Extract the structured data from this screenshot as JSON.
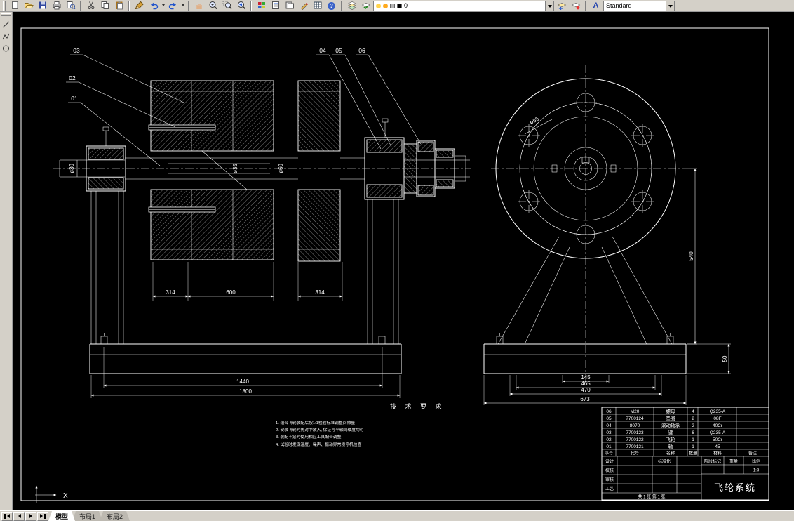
{
  "toolbar": {
    "layer_value": "0",
    "style_value": "Standard",
    "icons": {
      "help_glyph": "?",
      "style_glyph": "A"
    }
  },
  "tabs": {
    "model": "模型",
    "layout1": "布局1",
    "layout2": "布局2"
  },
  "drawing": {
    "callouts": [
      "01",
      "02",
      "03",
      "04",
      "05",
      "06"
    ],
    "dims": {
      "hub_width": "314",
      "flywheel_width": "600",
      "gear_width": "314",
      "bolt_span": "1440",
      "base_length": "1800",
      "d145": "145",
      "d465": "465",
      "d470": "470",
      "d673": "673",
      "height_540": "540",
      "plate_50": "50",
      "dia65": "ø65",
      "dia30": "ø30",
      "dia35": "ø35",
      "dia60": "ø60"
    },
    "tech": {
      "title": "技 术 要 求",
      "notes": [
        "1. 组合飞轮装配后按1:1检验标准调整间隙量",
        "2. 安装飞轮时先对中放入, 保证与半轴同轴度均匀",
        "3. 装配不紧时使用相应工具配合调整",
        "4. 试验时发现温度、噪声、振动异常须停机检查"
      ]
    },
    "ucs": {
      "x_label": "X"
    },
    "parts_list": {
      "header": {
        "no": "序号",
        "code": "代号",
        "name": "名称",
        "qty": "数量",
        "mtl": "材料",
        "rmk": "备注"
      },
      "rows": [
        {
          "no": "06",
          "code": "M20",
          "name": "螺母",
          "qty": "4",
          "mtl": "Q235-A"
        },
        {
          "no": "05",
          "code": "7700124",
          "name": "垫圈",
          "qty": "2",
          "mtl": "08F"
        },
        {
          "no": "04",
          "code": "8070",
          "name": "滚动轴承",
          "qty": "2",
          "mtl": "40Cr"
        },
        {
          "no": "03",
          "code": "7700123",
          "name": "键",
          "qty": "6",
          "mtl": "Q235-A"
        },
        {
          "no": "02",
          "code": "7700122",
          "name": "飞轮",
          "qty": "1",
          "mtl": "50Cr"
        },
        {
          "no": "01",
          "code": "7700121",
          "name": "轴",
          "qty": "1",
          "mtl": "45"
        }
      ]
    },
    "titleblock": {
      "title": "飞轮系统",
      "design": "设计",
      "check": "校核",
      "review": "审核",
      "process": "工艺",
      "std": "标准化",
      "stage": "阶段标记",
      "weight": "重量",
      "scale": "比例",
      "scale_val": "1:3",
      "sheets": "共 1 张 第 1 张"
    }
  }
}
